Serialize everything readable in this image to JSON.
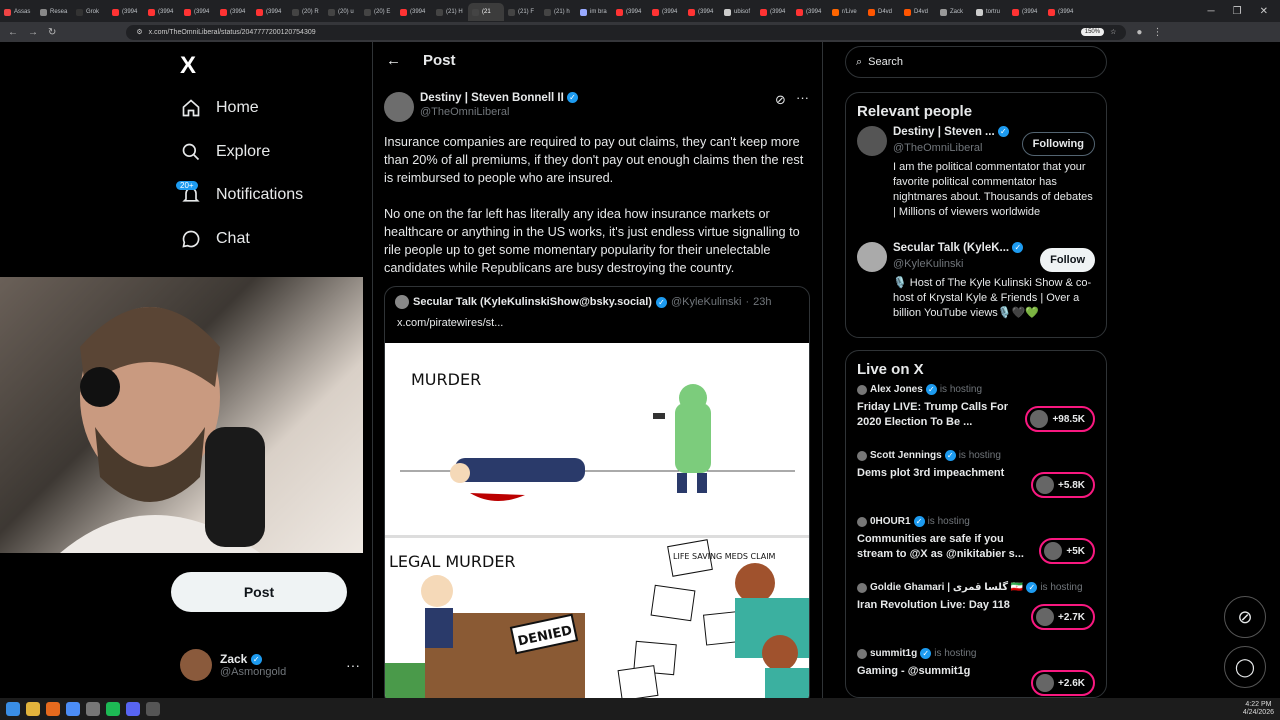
{
  "browser": {
    "tabs": [
      "Assas",
      "Resea",
      "Grok",
      "(3994",
      "(3994",
      "(3994",
      "(3994",
      "(3994",
      "(20) R",
      "(20) u",
      "(20) E",
      "(3994",
      "(21) H",
      "(21",
      "(21) F",
      "(21) h",
      "im bra",
      "(3994",
      "(3994",
      "(3994",
      "ubisof",
      "(3994",
      "(3994",
      "r/Live",
      "D4vd",
      "D4vd",
      "Zack",
      "tortru",
      "(3994",
      "(3994"
    ],
    "url": "x.com/TheOmniLiberal/status/2047777200120754309",
    "zoom": "150%"
  },
  "nav": {
    "logo": "X",
    "home": "Home",
    "explore": "Explore",
    "notifications": "Notifications",
    "notif_badge": "20+",
    "chat": "Chat",
    "post_button": "Post"
  },
  "account": {
    "name": "Zack",
    "handle": "@Asmongold"
  },
  "post_header": {
    "title": "Post"
  },
  "tweet": {
    "author_name": "Destiny | Steven Bonnell II",
    "author_handle": "@TheOmniLiberal",
    "paragraph1": "Insurance companies are required to pay out claims, they can't keep more than 20% of all premiums, if they don't pay out enough claims then the rest is reimbursed to people who are insured.",
    "paragraph2": "No one on the far left has literally any idea how insurance markets or healthcare or anything in the US works, it's just endless virtue signalling to rile people up to get some momentary popularity for their unelectable candidates while Republicans are busy destroying the country."
  },
  "quote": {
    "author_name": "Secular Talk (KyleKulinskiShow@bsky.social)",
    "handle": "@KyleKulinski",
    "time": "23h",
    "link": "x.com/piratewires/st...",
    "comic_top_label": "MURDER",
    "comic_bottom_label": "LEGAL MURDER",
    "denied_sign": "DENIED",
    "claims_text": "LIFE SAVING MEDS CLAIM"
  },
  "search": {
    "placeholder": "Search"
  },
  "relevant_people": {
    "title": "Relevant people",
    "people": [
      {
        "name": "Destiny | Steven ...",
        "handle": "@TheOmniLiberal",
        "bio": "I am the political commentator that your favorite political commentator has nightmares about. Thousands of debates | Millions of viewers worldwide",
        "button": "Following"
      },
      {
        "name": "Secular Talk (KyleK...",
        "handle": "@KyleKulinski",
        "bio": "🎙️ Host of The Kyle Kulinski Show & co-host of Krystal Kyle & Friends | Over a billion YouTube views🎙️🖤💚",
        "button": "Follow"
      }
    ]
  },
  "live": {
    "title": "Live on X",
    "hosting_label": "is hosting",
    "items": [
      {
        "host": "Alex Jones",
        "title": "Friday LIVE: Trump Calls For 2020 Election To Be ...",
        "count": "+98.5K"
      },
      {
        "host": "Scott Jennings",
        "title": "Dems plot 3rd impeachment",
        "count": "+5.8K"
      },
      {
        "host": "0HOUR1",
        "title": "Communities are safe if you stream to @X as @nikitabier s...",
        "count": "+5K"
      },
      {
        "host": "Goldie Ghamari | گلسا قمری 🇮🇷",
        "title": "Iran Revolution Live: Day 118",
        "count": "+2.7K"
      },
      {
        "host": "summit1g",
        "title": "Gaming - @summit1g",
        "count": "+2.6K"
      }
    ]
  },
  "taskbar": {
    "time": "4:22 PM",
    "date": "4/24/2026"
  }
}
